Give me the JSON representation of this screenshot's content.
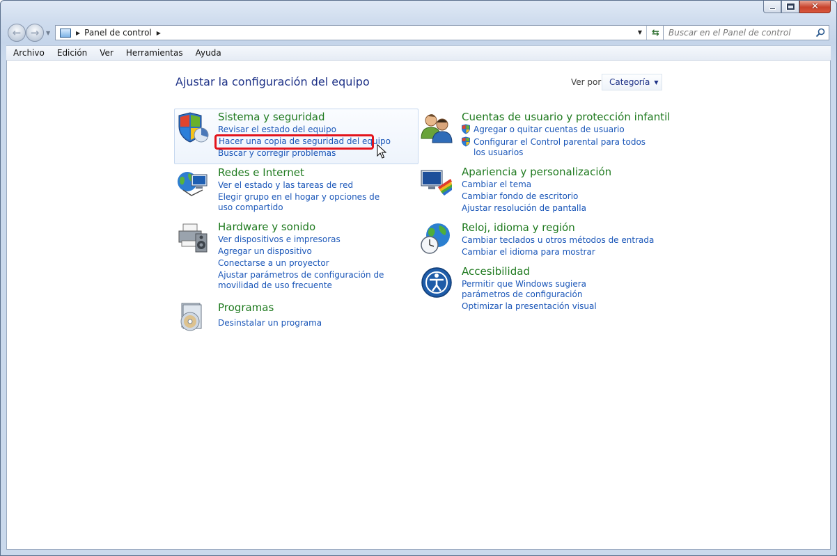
{
  "window": {
    "caption_buttons": [
      "minimize",
      "maximize",
      "close"
    ]
  },
  "nav": {
    "breadcrumb": "Panel de control",
    "search_placeholder": "Buscar en el Panel de control"
  },
  "menubar": {
    "items": [
      "Archivo",
      "Edición",
      "Ver",
      "Herramientas",
      "Ayuda"
    ]
  },
  "main": {
    "heading": "Ajustar la configuración del equipo",
    "view_by_label": "Ver por:",
    "view_by_value": "Categoría",
    "categories": {
      "system": {
        "title": "Sistema y seguridad",
        "icon": "shield-icon",
        "links": [
          "Revisar el estado del equipo",
          "Hacer una copia de seguridad del equipo",
          "Buscar y corregir problemas"
        ]
      },
      "network": {
        "title": "Redes e Internet",
        "icon": "network-globe-icon",
        "links": [
          "Ver el estado y las tareas de red",
          "Elegir grupo en el hogar y opciones de uso compartido"
        ]
      },
      "hardware": {
        "title": "Hardware y sonido",
        "icon": "printer-speaker-icon",
        "links": [
          "Ver dispositivos e impresoras",
          "Agregar un dispositivo",
          "Conectarse a un proyector",
          "Ajustar parámetros de configuración de movilidad de uso frecuente"
        ]
      },
      "programs": {
        "title": "Programas",
        "icon": "program-disc-icon",
        "links": [
          "Desinstalar un programa"
        ]
      },
      "users": {
        "title": "Cuentas de usuario y protección infantil",
        "icon": "users-icon",
        "links": [
          "Agregar o quitar cuentas de usuario",
          "Configurar el Control parental para todos los usuarios"
        ]
      },
      "appearance": {
        "title": "Apariencia y personalización",
        "icon": "monitor-palette-icon",
        "links": [
          "Cambiar el tema",
          "Cambiar fondo de escritorio",
          "Ajustar resolución de pantalla"
        ]
      },
      "clock": {
        "title": "Reloj, idioma y región",
        "icon": "globe-clock-icon",
        "links": [
          "Cambiar teclados u otros métodos de entrada",
          "Cambiar el idioma para mostrar"
        ]
      },
      "accessibility": {
        "title": "Accesibilidad",
        "icon": "accessibility-icon",
        "links": [
          "Permitir que Windows sugiera parámetros de configuración",
          "Optimizar la presentación visual"
        ]
      }
    }
  },
  "colors": {
    "category_title": "#1f7a1f",
    "link": "#1a56b8",
    "heading": "#1e3287",
    "highlight_box": "#e3141c"
  }
}
